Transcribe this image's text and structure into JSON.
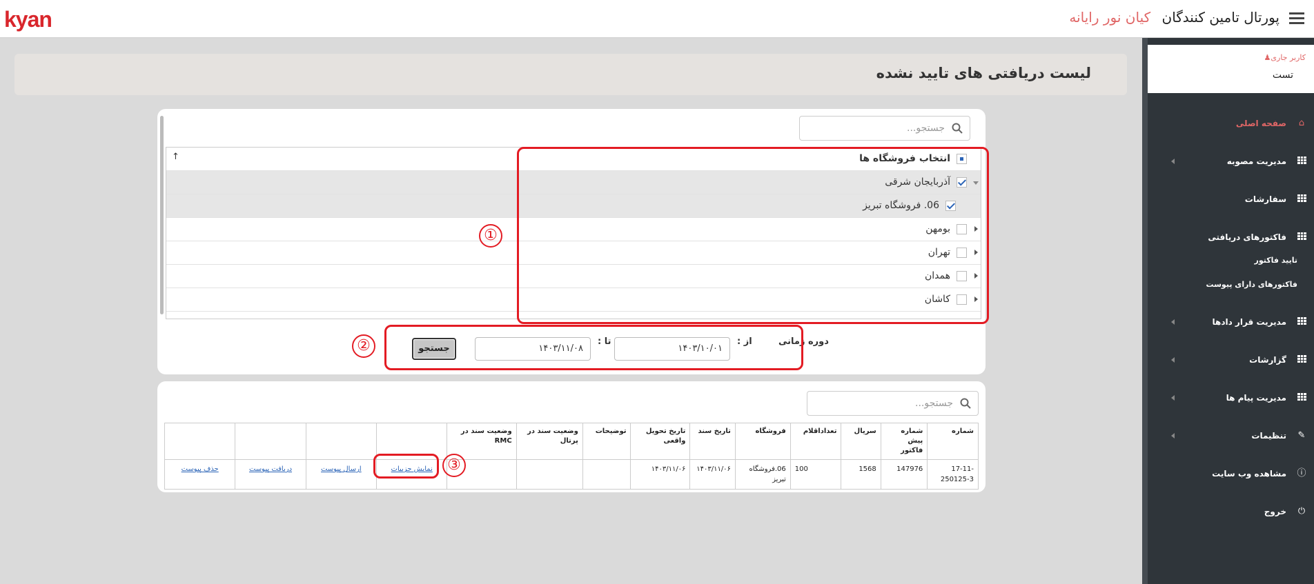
{
  "header": {
    "logo": "kyan",
    "portal_title": "پورتال تامین کنندگان",
    "company": "کیان نور رایانه"
  },
  "sidebar": {
    "user_label": "کاربر جاری",
    "user_name": "تست",
    "items": [
      {
        "label": "صفحه اصلی",
        "icon": "home-icon"
      },
      {
        "label": "مدیریت مصوبه",
        "icon": "grid-icon"
      },
      {
        "label": "سفارشات",
        "icon": "grid-icon"
      },
      {
        "label": "فاکتورهای دریافتی",
        "icon": "grid-icon"
      },
      {
        "label": "تایید فاکتور"
      },
      {
        "label": "فاکتورهای دارای پیوست"
      },
      {
        "label": "مدیریت قرار دادها",
        "icon": "grid-icon"
      },
      {
        "label": "گزارشات",
        "icon": "grid-icon"
      },
      {
        "label": "مدیریت پیام ها",
        "icon": "grid-icon"
      },
      {
        "label": "تنظیمات",
        "icon": "edit-icon"
      },
      {
        "label": "مشاهده وب سایت",
        "icon": "info-icon"
      },
      {
        "label": "خروج",
        "icon": "power-icon"
      }
    ]
  },
  "page": {
    "title": "لیست دریافتی های تایید نشده"
  },
  "filter": {
    "search_placeholder": "جستجو...",
    "tree_header": "انتخاب فروشگاه ها",
    "tree": [
      {
        "label": "آذربایجان شرقی",
        "checked": true
      },
      {
        "label": "06. فروشگاه تبریز",
        "checked": true
      },
      {
        "label": "بومهن",
        "checked": false
      },
      {
        "label": "تهران",
        "checked": false
      },
      {
        "label": "همدان",
        "checked": false
      },
      {
        "label": "کاشان",
        "checked": false
      }
    ],
    "period_label": "دوره زمانی",
    "from_label": "از :",
    "to_label": "تا :",
    "from_value": "۱۴۰۳/۱۰/۰۱",
    "to_value": "۱۴۰۳/۱۱/۰۸",
    "search_button": "جستجو"
  },
  "results": {
    "search_placeholder": "جستجو...",
    "columns": [
      "شماره",
      "شماره پیش فاکتور",
      "سریال",
      "تعداداقلام",
      "فروشگاه",
      "تاریخ سند",
      "تاریخ تحویل واقعی",
      "توضیحات",
      "وضعیت سند در پرتال",
      "وضعیت سند در RMC"
    ],
    "rows": [
      {
        "cells": [
          "17-11-250125-3",
          "147976",
          "1568",
          "100",
          "06.فروشگاه تبریز",
          "۱۴۰۳/۱۱/۰۶",
          "۱۴۰۳/۱۱/۰۶",
          "",
          "",
          ""
        ],
        "links": [
          "نمایش جزییات",
          "ارسال پیوست",
          "دریافت پیوست",
          "حذف پیوست"
        ]
      }
    ]
  },
  "annotations": [
    "①",
    "②",
    "③"
  ]
}
